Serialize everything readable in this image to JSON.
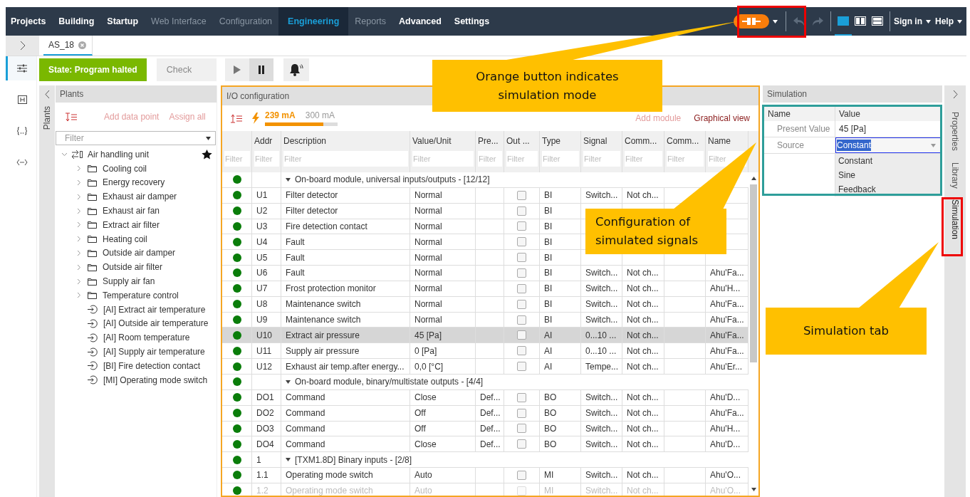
{
  "nav": {
    "items": [
      {
        "label": "Projects",
        "selected": false,
        "disabled": false
      },
      {
        "label": "Building",
        "selected": false,
        "disabled": false
      },
      {
        "label": "Startup",
        "selected": false,
        "disabled": false
      },
      {
        "label": "Web Interface",
        "selected": false,
        "disabled": true
      },
      {
        "label": "Configuration",
        "selected": false,
        "disabled": true
      },
      {
        "label": "Engineering",
        "selected": true,
        "disabled": false
      },
      {
        "label": "Reports",
        "selected": false,
        "disabled": true
      },
      {
        "label": "Advanced",
        "selected": false,
        "disabled": false
      },
      {
        "label": "Settings",
        "selected": false,
        "disabled": false
      }
    ],
    "simulation_mode": {
      "on": true
    },
    "layouts": [
      {
        "selected": true
      },
      {
        "selected": false
      },
      {
        "selected": false
      }
    ],
    "sign_in": "Sign in",
    "help": "Help"
  },
  "panel_toggle": {
    "expanded": false
  },
  "document_tabs": [
    {
      "label": "AS_18",
      "selected": true
    }
  ],
  "side_rail": [
    {
      "selected": true
    },
    {
      "selected": false
    },
    {
      "selected": false
    },
    {
      "selected": false
    }
  ],
  "toolbar": {
    "state": "State: Program halted",
    "check": "Check",
    "playback": [
      {
        "kind": "play",
        "selected": false
      },
      {
        "kind": "pause",
        "selected": true
      }
    ]
  },
  "plants": {
    "rail_label": "Plants",
    "title": "Plants",
    "add_data_point": "Add data point",
    "assign_all": "Assign all",
    "filter": {
      "placeholder": "Filter"
    },
    "tree": [
      {
        "label": "Air handling unit",
        "expanded": true,
        "favorite": true,
        "children": [
          {
            "label": "Cooling coil",
            "kind": "folder",
            "expanded": false
          },
          {
            "label": "Energy recovery",
            "kind": "folder",
            "expanded": false
          },
          {
            "label": "Exhaust air damper",
            "kind": "folder",
            "expanded": false
          },
          {
            "label": "Exhaust air fan",
            "kind": "folder",
            "expanded": false
          },
          {
            "label": "Extract air filter",
            "kind": "folder",
            "expanded": false
          },
          {
            "label": "Heating coil",
            "kind": "folder",
            "expanded": false
          },
          {
            "label": "Outside air damper",
            "kind": "folder",
            "expanded": false
          },
          {
            "label": "Outside air filter",
            "kind": "folder",
            "expanded": false
          },
          {
            "label": "Supply air fan",
            "kind": "folder",
            "expanded": false
          },
          {
            "label": "Temperature control",
            "kind": "folder",
            "expanded": false
          },
          {
            "label": "[AI] Extract air temperature",
            "kind": "point"
          },
          {
            "label": "[AI] Outside air temperature",
            "kind": "point"
          },
          {
            "label": "[AI] Room temperature",
            "kind": "point"
          },
          {
            "label": "[AI] Supply air temperature",
            "kind": "point"
          },
          {
            "label": "[BI] Fire detection contact",
            "kind": "point"
          },
          {
            "label": "[MI] Operating mode switch",
            "kind": "point"
          }
        ]
      }
    ]
  },
  "io": {
    "title": "I/O configuration",
    "current": "239 mA",
    "max": "300 mA",
    "level": 0.8,
    "add_module": "Add module",
    "graphical_view": "Graphical view",
    "columns": [
      {
        "placeholder": "Filter"
      },
      {
        "label": "Addr",
        "placeholder": "Filter"
      },
      {
        "label": "Description",
        "placeholder": "Filter"
      },
      {
        "label": "Value/Unit",
        "placeholder": "Filter"
      },
      {
        "label": "Pre...",
        "placeholder": "Filter"
      },
      {
        "label": "Out ...",
        "placeholder": "Filter"
      },
      {
        "label": "Type",
        "placeholder": "Filter"
      },
      {
        "label": "Signal",
        "placeholder": "Filter"
      },
      {
        "label": "Comm...",
        "placeholder": "Filter"
      },
      {
        "label": "Comm...",
        "placeholder": "Filter"
      },
      {
        "label": "Name",
        "placeholder": "Filter"
      }
    ],
    "rows": [
      {
        "kind": "group",
        "label": "On-board module, universal inputs/outputs - [12/12]",
        "expanded": true,
        "selected": false
      },
      {
        "kind": "point",
        "addr": "U1",
        "description": "Filter detector",
        "value": "Normal",
        "out": false,
        "type": "BI",
        "signal": "Switch...",
        "comm": "Not ch...",
        "selected": false,
        "disabled": false
      },
      {
        "kind": "point",
        "addr": "U2",
        "description": "Filter detector",
        "value": "Normal",
        "out": false,
        "type": "BI",
        "selected": false,
        "disabled": false
      },
      {
        "kind": "point",
        "addr": "U3",
        "description": "Fire detection contact",
        "value": "Normal",
        "out": false,
        "type": "BI",
        "selected": false,
        "disabled": false
      },
      {
        "kind": "point",
        "addr": "U4",
        "description": "Fault",
        "value": "Normal",
        "out": false,
        "type": "BI",
        "selected": false,
        "disabled": false
      },
      {
        "kind": "point",
        "addr": "U5",
        "description": "Fault",
        "value": "Normal",
        "out": false,
        "type": "BI",
        "selected": false,
        "disabled": false
      },
      {
        "kind": "point",
        "addr": "U6",
        "description": "Fault",
        "value": "Normal",
        "out": false,
        "type": "BI",
        "signal": "Switch...",
        "comm": "Not ch...",
        "name": "Ahu'Fa...",
        "selected": false,
        "disabled": false
      },
      {
        "kind": "point",
        "addr": "U7",
        "description": "Frost protection monitor",
        "value": "Normal",
        "out": false,
        "type": "BI",
        "signal": "Switch...",
        "comm": "Not ch...",
        "name": "Ahu'H...",
        "selected": false,
        "disabled": false
      },
      {
        "kind": "point",
        "addr": "U8",
        "description": "Maintenance switch",
        "value": "Normal",
        "out": false,
        "type": "BI",
        "signal": "Switch...",
        "comm": "Not ch...",
        "name": "Ahu'Fa...",
        "selected": false,
        "disabled": false
      },
      {
        "kind": "point",
        "addr": "U9",
        "description": "Maintenance switch",
        "value": "Normal",
        "out": false,
        "type": "BI",
        "signal": "Switch...",
        "comm": "Not ch...",
        "name": "Ahu'Fa...",
        "selected": false,
        "disabled": false
      },
      {
        "kind": "point",
        "addr": "U10",
        "description": "Extract air pressure",
        "value": "45 [Pa]",
        "out": false,
        "type": "AI",
        "signal": "0...10 ...",
        "comm": "Not ch...",
        "name": "Ahu'Fa...",
        "selected": true,
        "disabled": false
      },
      {
        "kind": "point",
        "addr": "U11",
        "description": "Supply air pressure",
        "value": "0 [Pa]",
        "out": false,
        "type": "AI",
        "signal": "0...10 ...",
        "comm": "Not ch...",
        "name": "Ahu'Fa...",
        "selected": false,
        "disabled": false
      },
      {
        "kind": "point",
        "addr": "U12",
        "description": "Exhaust air temp.after energy...",
        "value": "0,0 [°C]",
        "out": false,
        "type": "AI",
        "signal": "Tempe...",
        "comm": "Not ch...",
        "name": "Ahu'Er...",
        "selected": false,
        "disabled": false
      },
      {
        "kind": "group",
        "label": "On-board module, binary/multistate outputs - [4/4]",
        "expanded": true,
        "selected": false
      },
      {
        "kind": "point",
        "addr": "DO1",
        "description": "Command",
        "value": "Close",
        "pre": "Def...",
        "out": false,
        "type": "BO",
        "signal": "Switch...",
        "comm": "Not ch...",
        "name": "Ahu'D...",
        "selected": false,
        "disabled": false
      },
      {
        "kind": "point",
        "addr": "DO2",
        "description": "Command",
        "value": "Off",
        "pre": "Def...",
        "out": false,
        "type": "BO",
        "signal": "Switch...",
        "comm": "Not ch...",
        "name": "Ahu'Fa...",
        "selected": false,
        "disabled": false
      },
      {
        "kind": "point",
        "addr": "DO3",
        "description": "Command",
        "value": "Off",
        "pre": "Def...",
        "out": false,
        "type": "BO",
        "signal": "Switch...",
        "comm": "Not ch...",
        "name": "Ahu'H...",
        "selected": false,
        "disabled": false
      },
      {
        "kind": "point",
        "addr": "DO4",
        "description": "Command",
        "value": "Close",
        "pre": "Def...",
        "out": false,
        "type": "BO",
        "signal": "Switch...",
        "comm": "Not ch...",
        "name": "Ahu'D...",
        "selected": false,
        "disabled": false
      },
      {
        "kind": "group",
        "addr": "1",
        "label": "[TXM1.8D] Binary inputs - [2/8]",
        "expanded": true,
        "selected": false
      },
      {
        "kind": "point",
        "addr": "1.1",
        "description": "Operating mode switch",
        "value": "Auto",
        "out": false,
        "type": "MI",
        "signal": "Switch...",
        "comm": "Not ch...",
        "name": "Ahu'O...",
        "selected": false,
        "disabled": false
      },
      {
        "kind": "point",
        "addr": "1.2",
        "description": "Operating mode switch",
        "value": "Auto",
        "out": false,
        "type": "MI",
        "signal": "Switch...",
        "comm": "Not ch...",
        "name": "Ahu'O...",
        "selected": false,
        "disabled": true
      }
    ]
  },
  "simulation": {
    "title": "Simulation",
    "name_header": "Name",
    "value_header": "Value",
    "properties": [
      {
        "name": "Present Value",
        "value": "45 [Pa]",
        "kind": "text"
      },
      {
        "name": "Source",
        "value": "Constant",
        "kind": "dropdown"
      }
    ],
    "options": [
      "Constant",
      "Sine",
      "Feedback"
    ]
  },
  "side_tabs": [
    {
      "label": "Properties",
      "selected": false
    },
    {
      "label": "Library",
      "selected": false
    },
    {
      "label": "Simulation",
      "selected": true
    }
  ],
  "callouts": [
    {
      "text": "Orange button indicates simulation mode",
      "kind": "top"
    },
    {
      "text": "Configuration of simulated signals",
      "kind": "middle"
    },
    {
      "text": "Simulation tab",
      "kind": "bottom"
    }
  ]
}
